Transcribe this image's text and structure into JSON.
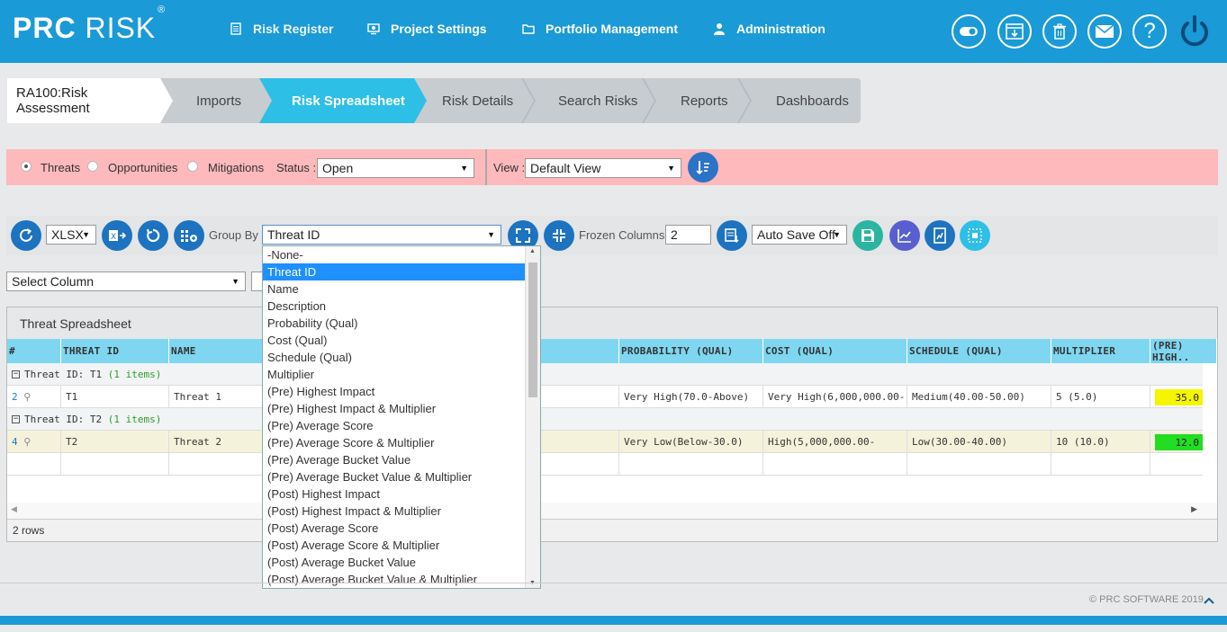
{
  "header": {
    "logo_bold": "PRC",
    "logo_light": "RISK",
    "logo_mark": "®",
    "nav": [
      {
        "label": "Risk Register",
        "icon": "list-icon"
      },
      {
        "label": "Project Settings",
        "icon": "settings-screen-icon"
      },
      {
        "label": "Portfolio Management",
        "icon": "folder-icon"
      },
      {
        "label": "Administration",
        "icon": "user-icon"
      }
    ],
    "right_icons": [
      "toggle-icon",
      "download-window-icon",
      "trash-icon",
      "mail-icon",
      "help-icon",
      "power-icon"
    ],
    "help_glyph": "?"
  },
  "breadcrumb": {
    "project": "RA100:Risk Assessment",
    "steps": [
      "Imports",
      "Risk Spreadsheet",
      "Risk Details",
      "Search Risks",
      "Reports",
      "Dashboards"
    ],
    "active": "Risk Spreadsheet"
  },
  "filter": {
    "types": [
      "Threats",
      "Opportunities",
      "Mitigations"
    ],
    "selected_type": "Threats",
    "status_label": "Status :",
    "status_value": "Open",
    "view_label": "View :",
    "view_value": "Default View"
  },
  "toolbar": {
    "export_format": "XLSX",
    "group_by_label": "Group By :",
    "group_by_value": "Threat ID",
    "frozen_label": "Frozen Columns :",
    "frozen_value": "2",
    "autosave_value": "Auto Save Off",
    "select_column": "Select Column"
  },
  "grid": {
    "title": "Threat Spreadsheet",
    "columns": [
      "#",
      "THREAT ID",
      "NAME",
      "PROBABILITY (QUAL)",
      "COST (QUAL)",
      "SCHEDULE (QUAL)",
      "MULTIPLIER",
      "(PRE) HIGH.."
    ],
    "groups": [
      {
        "label": "Threat ID: T1",
        "count": "(1 items)",
        "row": {
          "num": "2",
          "id": "T1",
          "name": "Threat 1",
          "prob": "Very High(70.0-Above)",
          "cost": "Very High(6,000,000.00-",
          "schedule": "Medium(40.00-50.00)",
          "multiplier": "5 (5.0)",
          "pre_high": "35.0",
          "pre_color": "#f5f500"
        }
      },
      {
        "label": "Threat ID: T2",
        "count": "(1 items)",
        "row": {
          "num": "4",
          "id": "T2",
          "name": "Threat 2",
          "prob": "Very Low(Below-30.0)",
          "cost": "High(5,000,000.00-",
          "schedule": "Low(30.00-40.00)",
          "multiplier": "10 (10.0)",
          "pre_high": "12.0",
          "pre_color": "#22dd22"
        }
      }
    ],
    "footer": "2 rows"
  },
  "dropdown_options": [
    "-None-",
    "Threat ID",
    "Name",
    "Description",
    "Probability (Qual)",
    "Cost (Qual)",
    "Schedule (Qual)",
    "Multiplier",
    "(Pre) Highest Impact",
    "(Pre) Highest Impact & Multiplier",
    "(Pre) Average Score",
    "(Pre) Average Score & Multiplier",
    "(Pre) Average Bucket Value",
    "(Pre) Average Bucket Value & Multiplier",
    "(Post) Highest Impact",
    "(Post) Highest Impact & Multiplier",
    "(Post) Average Score",
    "(Post) Average Score & Multiplier",
    "(Post) Average Bucket Value",
    "(Post) Average Bucket Value & Multiplier"
  ],
  "dropdown_selected": "Threat ID",
  "copyright": "© PRC SOFTWARE 2019"
}
